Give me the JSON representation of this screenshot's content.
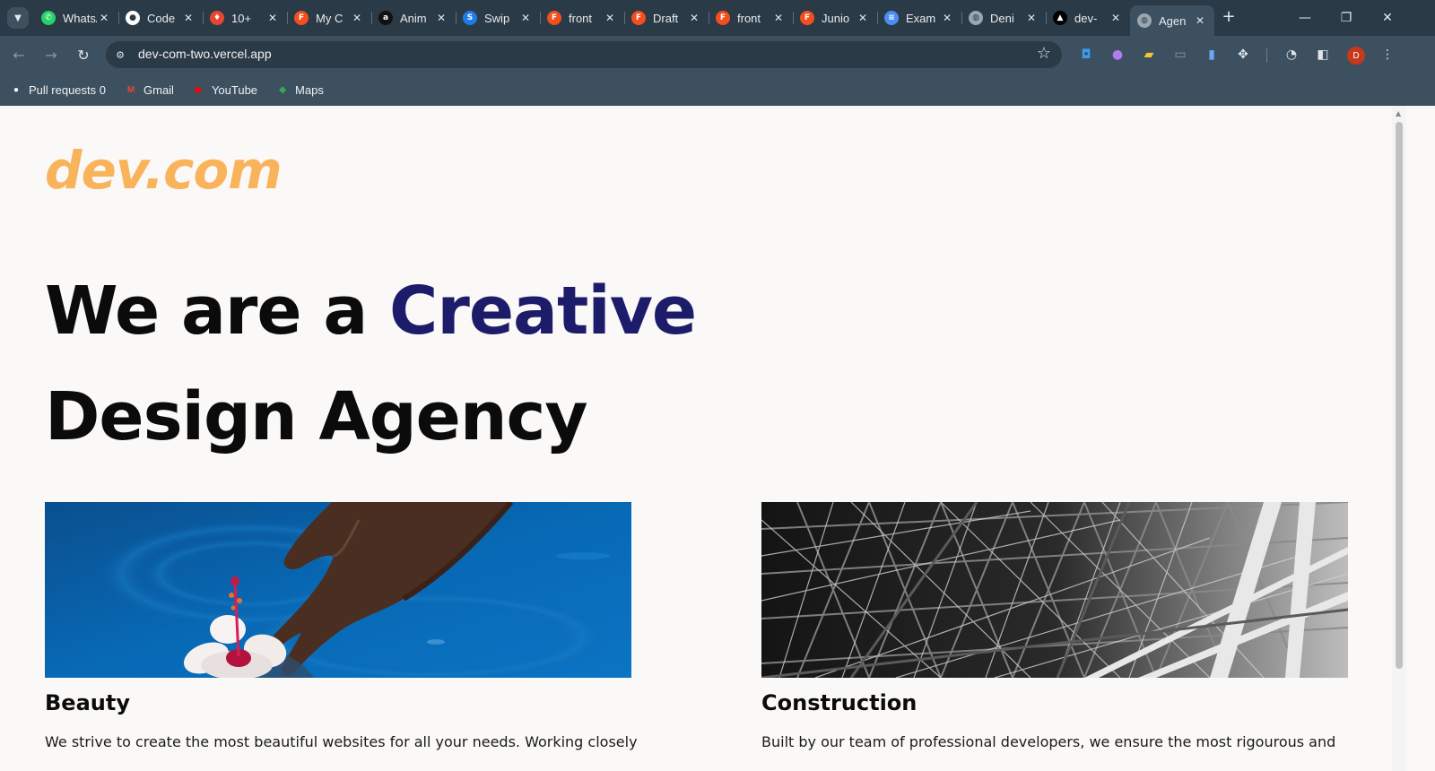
{
  "browser": {
    "tabs": [
      {
        "title": "WhatsApp",
        "icon": "whatsapp-icon",
        "color": "#25d366",
        "glyph": "✆"
      },
      {
        "title": "Code",
        "icon": "github-icon",
        "color": "#ffffff",
        "glyph": "●"
      },
      {
        "title": "10+",
        "icon": "fire-icon",
        "color": "#e9452f",
        "glyph": "♦"
      },
      {
        "title": "My C",
        "icon": "figma-icon",
        "color": "#f24e1e",
        "glyph": "F"
      },
      {
        "title": "Anim",
        "icon": "amazon-icon",
        "color": "#111111",
        "glyph": "a"
      },
      {
        "title": "Swip",
        "icon": "swiper-icon",
        "color": "#1f7bea",
        "glyph": "S"
      },
      {
        "title": "front",
        "icon": "figma-icon",
        "color": "#f24e1e",
        "glyph": "F"
      },
      {
        "title": "Draft",
        "icon": "figma-icon",
        "color": "#f24e1e",
        "glyph": "F"
      },
      {
        "title": "front",
        "icon": "figma-icon",
        "color": "#f24e1e",
        "glyph": "F"
      },
      {
        "title": "Junio",
        "icon": "figma-icon",
        "color": "#f24e1e",
        "glyph": "F"
      },
      {
        "title": "Exam",
        "icon": "docs-icon",
        "color": "#4a8df6",
        "glyph": "≡"
      },
      {
        "title": "Deni",
        "icon": "globe-icon",
        "color": "#9aa6b0",
        "glyph": "◍"
      },
      {
        "title": "dev-",
        "icon": "vercel-icon",
        "color": "#000000",
        "glyph": "▲"
      },
      {
        "title": "Agen",
        "icon": "globe-icon",
        "color": "#9aa6b0",
        "glyph": "◍",
        "active": true
      }
    ],
    "url": "dev-com-two.vercel.app",
    "avatar_letter": "D",
    "bookmarks": [
      {
        "label": "Pull requests 0",
        "icon": "github-icon",
        "color": "#ffffff",
        "glyph": "●"
      },
      {
        "label": "Gmail",
        "icon": "gmail-icon",
        "color": "#ea4335",
        "glyph": "M"
      },
      {
        "label": "YouTube",
        "icon": "youtube-icon",
        "color": "#ff0000",
        "glyph": "▶"
      },
      {
        "label": "Maps",
        "icon": "maps-icon",
        "color": "#34a853",
        "glyph": "◆"
      }
    ]
  },
  "page": {
    "logo": "dev.com",
    "hero_line1_plain": "We are a ",
    "hero_line1_accent": "Creative",
    "hero_line2": "Design Agency",
    "colors": {
      "logo": "#f9b35b",
      "accent": "#1c1c6b",
      "background": "#faf9f7"
    },
    "cards": [
      {
        "title": "Beauty",
        "text": "We strive to create the most beautiful websites for all your needs. Working closely",
        "image": "hand-in-water-with-hibiscus"
      },
      {
        "title": "Construction",
        "text": "Built by our team of professional developers, we ensure the most rigourous and",
        "image": "steel-framework-black-and-white"
      }
    ]
  }
}
